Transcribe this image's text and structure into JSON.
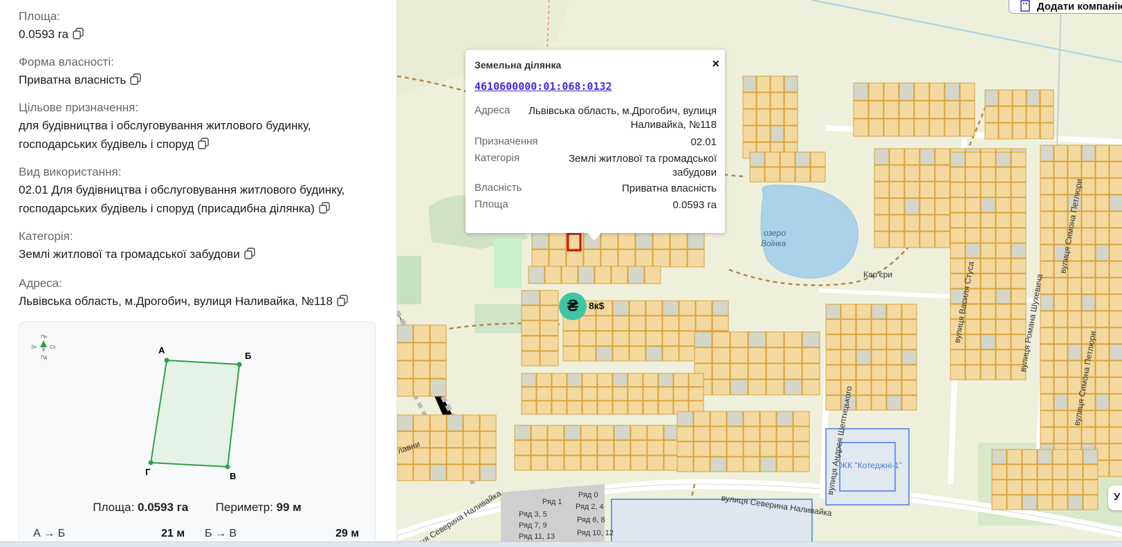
{
  "panel": {
    "area": {
      "label": "Площа:",
      "value": "0.0593 га"
    },
    "ownership": {
      "label": "Форма власності:",
      "value": "Приватна власність"
    },
    "purpose": {
      "label": "Цільове призначення:",
      "line1": "для будівництва і обслуговування житлового будинку,",
      "line2": "господарських будівель і споруд"
    },
    "usage": {
      "label": "Вид використання:",
      "line1": "02.01 Для будівництва і обслуговування житлового будинку,",
      "line2": "господарських будівель і споруд (присадибна ділянка)"
    },
    "category": {
      "label": "Категорія:",
      "value": "Землі житлової та громадської забудови"
    },
    "address": {
      "label": "Адреса:",
      "value": "Львівська область, м.Дрогобич, вулиця Наливайка, №118"
    }
  },
  "shape": {
    "compass": {
      "n": "Пн",
      "s": "Пд",
      "w": "Зх",
      "e": "Сх"
    },
    "vertices": {
      "a": "А",
      "b": "Б",
      "c": "В",
      "d": "Г"
    },
    "area_label": "Площа:",
    "area_value": "0.0593 га",
    "perimeter_label": "Периметр:",
    "perimeter_value": "99 м",
    "edges": [
      {
        "label": "А → Б",
        "value": "21 м"
      },
      {
        "label": "Б → В",
        "value": "29 м"
      }
    ]
  },
  "popup": {
    "title": "Земельна ділянка",
    "close": "×",
    "cadastral": "4610600000:01:068:0132",
    "rows": [
      {
        "key": "Адреса",
        "value1": "Львівська область, м.Дрогобич, вулиця",
        "value2": "Наливайка, №118"
      },
      {
        "key": "Призначення",
        "value1": "02.01"
      },
      {
        "key": "Категорія",
        "value1": "Землі житлової та громадської",
        "value2": "забудови"
      },
      {
        "key": "Власність",
        "value1": "Приватна власність"
      },
      {
        "key": "Площа",
        "value1": "0.0593 га"
      }
    ]
  },
  "map": {
    "top_button": "Додати компанію",
    "right_button": "У",
    "price_marker": "₴",
    "price_label": "8к$",
    "labels": {
      "lake": "озеро",
      "lake2": "Воїнка",
      "quarry": "Кар'єри",
      "street_naliv": "вулиця Северина Наливайка",
      "street_naliv2": "вулиця Северина Наливайка",
      "street_sheptytsky": "вулиця Андрея Шептицького",
      "street_stusa": "вулиця Василя Стуса",
      "street_shukhevycha": "вулиця Романа Шухевича",
      "street_petliury": "вулиця Симона Петлюри",
      "street_petliury2": "вулиця Симона Петлюри",
      "cottage": "ЖК \"Котеджні-1\"",
      "lavni": "лавни",
      "rows": [
        "Ряд 0",
        "Ряд 1",
        "Ряд 2, 4",
        "Ряд 3, 5",
        "Ряд 6, 8",
        "Ряд 7, 9",
        "Ряд 10, 12",
        "Ряд 11, 13"
      ]
    }
  }
}
